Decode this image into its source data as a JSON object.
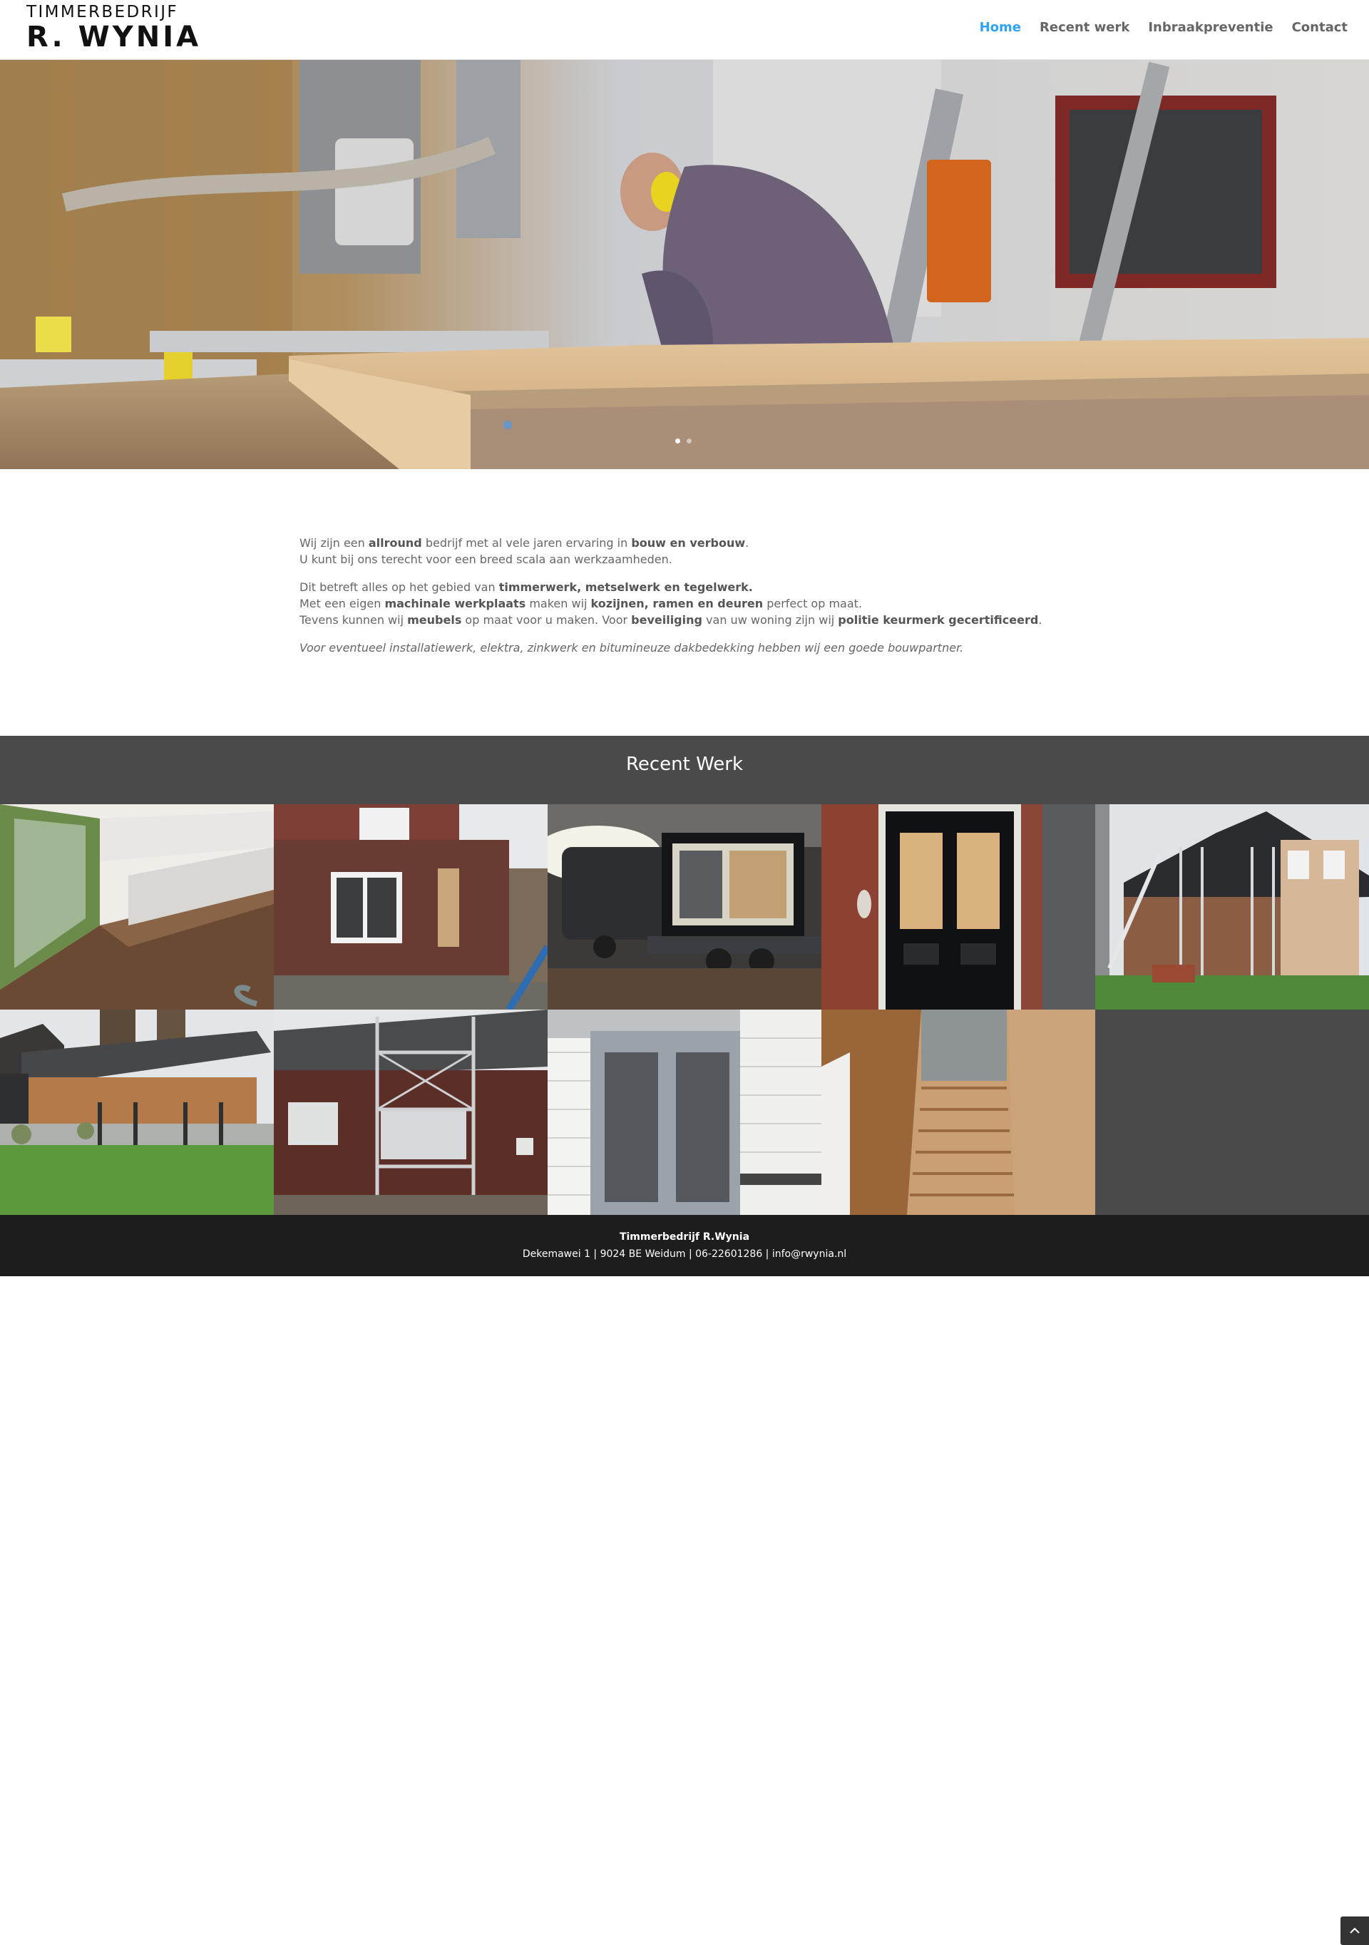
{
  "header": {
    "logo_line1": "TIMMERBEDRIJF",
    "logo_line2": "R. WYNIA",
    "nav": [
      "Home",
      "Recent werk",
      "Inbraakpreventie",
      "Contact"
    ],
    "active_nav": "Home",
    "accent_color": "#2ea3f2"
  },
  "hero": {
    "slide_count": 2,
    "active_slide": 1
  },
  "intro": {
    "p1": [
      {
        "t": "Wij zijn een ",
        "b": false
      },
      {
        "t": "allround",
        "b": true
      },
      {
        "t": " bedrijf met al vele jaren ervaring in ",
        "b": false
      },
      {
        "t": "bouw en verbouw",
        "b": true
      },
      {
        "t": ".",
        "b": false
      },
      {
        "br": true
      },
      {
        "t": "U kunt bij ons terecht voor een breed scala aan werkzaamheden.",
        "b": false
      }
    ],
    "p2": [
      {
        "t": "Dit betreft alles op het gebied van ",
        "b": false
      },
      {
        "t": "timmerwerk, metselwerk en tegelwerk.",
        "b": true
      },
      {
        "br": true
      },
      {
        "t": "Met een eigen ",
        "b": false
      },
      {
        "t": "machinale werkplaats",
        "b": true
      },
      {
        "t": " maken wij ",
        "b": false
      },
      {
        "t": "kozijnen, ramen en deuren",
        "b": true
      },
      {
        "t": " perfect op maat.",
        "b": false
      },
      {
        "br": true
      },
      {
        "t": "Tevens kunnen wij ",
        "b": false
      },
      {
        "t": "meubels",
        "b": true
      },
      {
        "t": " op maat voor u maken. Voor ",
        "b": false
      },
      {
        "t": "beveiliging",
        "b": true
      },
      {
        "t": " van uw woning zijn wij ",
        "b": false
      },
      {
        "t": "politie keurmerk gecertificeerd",
        "b": true
      },
      {
        "t": ".",
        "b": false
      }
    ],
    "p3": "Voor eventueel installatiewerk, elektra, zinkwerk en bitumineuze dakbedekking hebben wij een goede bouwpartner."
  },
  "recent": {
    "title": "Recent Werk",
    "photos": [
      "wooden-floor-window",
      "brick-extension",
      "trailer-window-frame",
      "black-double-door",
      "house-scaffolding",
      "garden-shed",
      "scaffold-brick-house",
      "white-french-doors",
      "wooden-staircase"
    ]
  },
  "footer": {
    "company": "Timmerbedrijf R.Wynia",
    "details": "Dekemawei 1 | 9024 BE Weidum | 06-22601286 | info@rwynia.nl"
  },
  "back_to_top_icon": "chevron-up-icon"
}
